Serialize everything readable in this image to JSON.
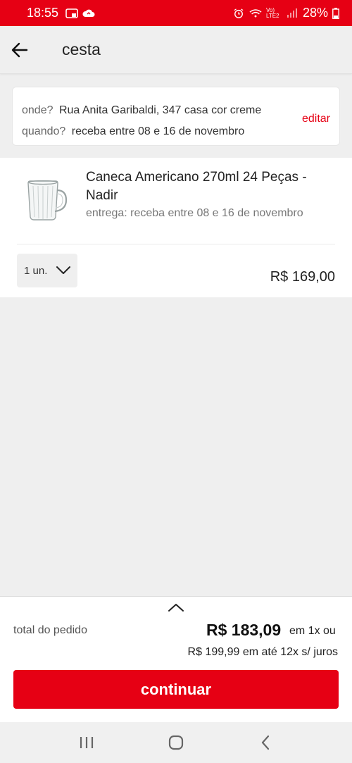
{
  "status_bar": {
    "time": "18:55",
    "battery": "28%",
    "network_label": "Vo) LTE2",
    "icons": [
      "cast-icon",
      "cloud-sync-icon",
      "alarm-icon",
      "wifi-icon",
      "signal-icon",
      "battery-icon"
    ]
  },
  "header": {
    "title": "cesta",
    "back_icon": "arrow-left-icon"
  },
  "delivery": {
    "where_label": "onde?",
    "where_value": "Rua Anita Garibaldi, 347 casa cor creme",
    "when_label": "quando?",
    "when_value": "receba entre 08 e 16 de novembro",
    "edit_label": "editar"
  },
  "product": {
    "name": "Caneca Americano 270ml 24 Peças - Nadir",
    "delivery_text": "entrega: receba entre 08 e 16 de novembro",
    "quantity": "1 un.",
    "price": "R$ 169,00"
  },
  "summary": {
    "total_label": "total do pedido",
    "total_amount": "R$ 183,09",
    "total_suffix": "em 1x ou",
    "installments": "R$ 199,99 em até 12x s/ juros",
    "continue_label": "continuar"
  },
  "colors": {
    "brand_red": "#e60014",
    "background": "#efefef"
  }
}
